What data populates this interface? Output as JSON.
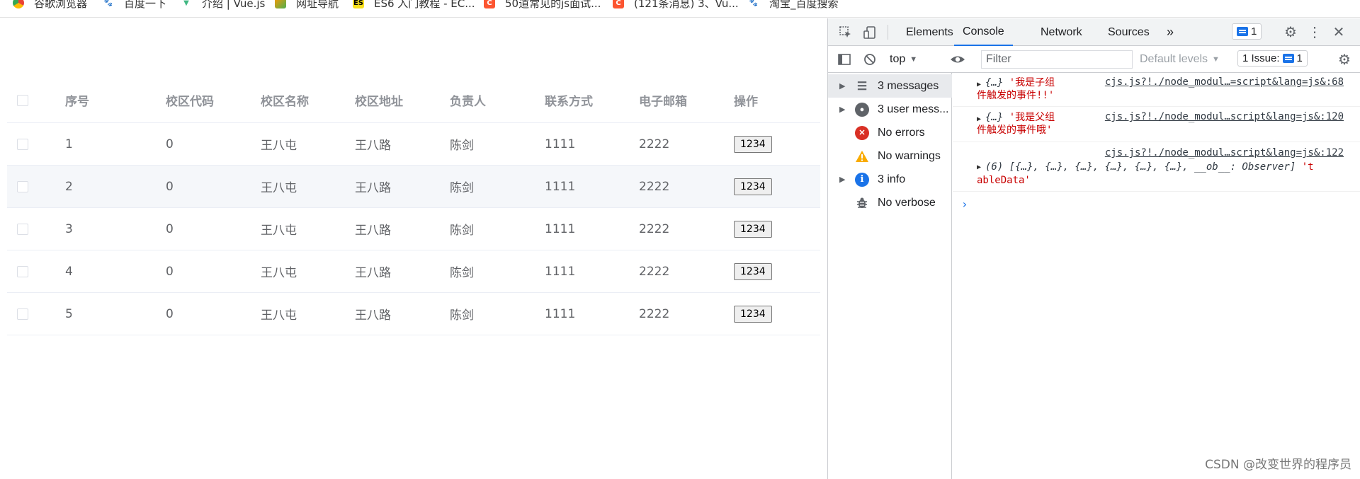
{
  "bookmarks": [
    {
      "label": "谷歌浏览器",
      "icon": "chrome-icon"
    },
    {
      "label": "百度一下",
      "icon": "baidu-paw-icon"
    },
    {
      "label": "介绍 | Vue.js",
      "icon": "vue-icon"
    },
    {
      "label": "网址导航",
      "icon": "navigation-icon"
    },
    {
      "label": "ES6 入门教程 - EC...",
      "icon": "es6-icon"
    },
    {
      "label": "50道常见的js面试...",
      "icon": "csdn-icon"
    },
    {
      "label": "(121条消息) 3、Vu...",
      "icon": "csdn-icon"
    },
    {
      "label": "淘宝_百度搜索",
      "icon": "baidu-paw-icon"
    }
  ],
  "table": {
    "headers": [
      "序号",
      "校区代码",
      "校区名称",
      "校区地址",
      "负责人",
      "联系方式",
      "电子邮箱",
      "操作"
    ],
    "rows": [
      {
        "index": "1",
        "code": "0",
        "name": "王八屯",
        "address": "王八路",
        "leader": "陈剑",
        "phone": "1111",
        "email": "2222",
        "action": "1234"
      },
      {
        "index": "2",
        "code": "0",
        "name": "王八屯",
        "address": "王八路",
        "leader": "陈剑",
        "phone": "1111",
        "email": "2222",
        "action": "1234"
      },
      {
        "index": "3",
        "code": "0",
        "name": "王八屯",
        "address": "王八路",
        "leader": "陈剑",
        "phone": "1111",
        "email": "2222",
        "action": "1234"
      },
      {
        "index": "4",
        "code": "0",
        "name": "王八屯",
        "address": "王八路",
        "leader": "陈剑",
        "phone": "1111",
        "email": "2222",
        "action": "1234"
      },
      {
        "index": "5",
        "code": "0",
        "name": "王八屯",
        "address": "王八路",
        "leader": "陈剑",
        "phone": "1111",
        "email": "2222",
        "action": "1234"
      }
    ]
  },
  "devtools": {
    "tabs": [
      "Elements",
      "Console",
      "Network",
      "Sources"
    ],
    "active_tab": "Console",
    "more_tabs": "»",
    "issues_badge": "1",
    "context": "top",
    "filter_placeholder": "Filter",
    "levels": "Default levels",
    "issues_label": "1 Issue:",
    "issues_count": "1",
    "sidebar": [
      {
        "label": "3 messages",
        "icon": "list-icon",
        "expandable": true
      },
      {
        "label": "3 user mess...",
        "icon": "user-icon",
        "expandable": true
      },
      {
        "label": "No errors",
        "icon": "error-icon",
        "expandable": false
      },
      {
        "label": "No warnings",
        "icon": "warning-icon",
        "expandable": false
      },
      {
        "label": "3 info",
        "icon": "info-icon",
        "expandable": true
      },
      {
        "label": "No verbose",
        "icon": "bug-icon",
        "expandable": false
      }
    ],
    "messages": [
      {
        "obj": "{…}",
        "text_line1": "'我是子组",
        "text_line2": "件触发的事件!!'",
        "source": "cjs.js?!./node_modul…=script&lang=js&:68"
      },
      {
        "obj": "{…}",
        "text_line1": "'我是父组",
        "text_line2": "件触发的事件哦'",
        "source": "cjs.js?!./node_modul…script&lang=js&:120"
      },
      {
        "source": "cjs.js?!./node_modul…script&lang=js&:122",
        "obj": "(6) [{…}, {…}, {…}, {…}, {…}, {…}, __ob__: Observer]",
        "text_line1": "'t",
        "text_line2": "ableData'"
      }
    ]
  },
  "watermark": "CSDN @改变世界的程序员",
  "colors": {
    "accent": "#1a73e8",
    "error": "#d93025",
    "warning": "#f9ab00",
    "string": "#c80000"
  }
}
